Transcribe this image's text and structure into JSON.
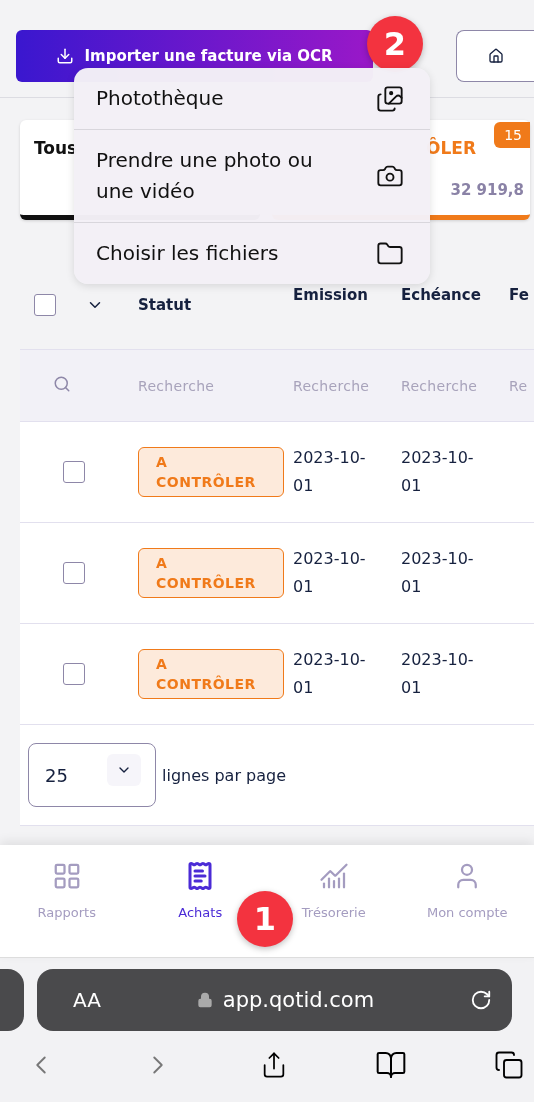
{
  "toolbar": {
    "import_button": "Importer une facture via OCR",
    "step_badge": "2"
  },
  "menu": [
    {
      "label": "Photothèque",
      "kind": "photos"
    },
    {
      "label": "Prendre une photo ou une vidéo",
      "kind": "camera"
    },
    {
      "label": "Choisir les fichiers",
      "kind": "folder"
    }
  ],
  "cards": [
    {
      "label": "Tous",
      "color": "#111111"
    },
    {
      "label": "ÔLER",
      "count": "15",
      "amount": "32 919,8",
      "color": "#f07a1a"
    }
  ],
  "table": {
    "select_all": {
      "checked": false
    },
    "columns": [
      "Statut",
      "Emission",
      "Echéance",
      "Fe"
    ],
    "search_placeholders": [
      "Recherche",
      "Recherche",
      "Recherche",
      "Re"
    ],
    "rows": [
      {
        "checked": false,
        "status": "A CONTRÔLER",
        "emission": "2023-10-01",
        "due": "2023-10-01"
      },
      {
        "checked": false,
        "status": "A CONTRÔLER",
        "emission": "2023-10-01",
        "due": "2023-10-01"
      },
      {
        "checked": false,
        "status": "A CONTRÔLER",
        "emission": "2023-10-01",
        "due": "2023-10-01"
      }
    ]
  },
  "pagination": {
    "page_size": "25",
    "label": "lignes par page"
  },
  "nav": [
    {
      "label": "Rapports",
      "kind": "reports",
      "selected": false
    },
    {
      "label": "Achats",
      "kind": "purchases",
      "selected": true
    },
    {
      "label": "Trésorerie",
      "kind": "treasury",
      "selected": false
    },
    {
      "label": "Mon compte",
      "kind": "account",
      "selected": false
    }
  ],
  "nav_step_badge": "1",
  "browser": {
    "text_size": "AA",
    "url": "app.qotid.com"
  }
}
